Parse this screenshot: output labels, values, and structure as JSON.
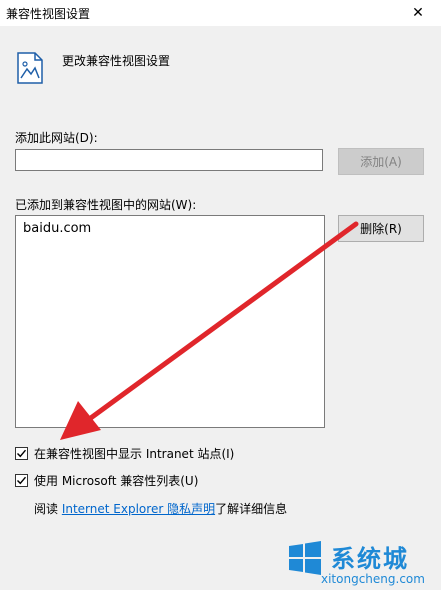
{
  "window": {
    "title": "兼容性视图设置",
    "close_symbol": "✕"
  },
  "header": {
    "text": "更改兼容性视图设置",
    "icon": "document-image-icon"
  },
  "add_site": {
    "label": "添加此网站(D):",
    "input_value": "",
    "input_placeholder": "",
    "button_label": "添加(A)"
  },
  "site_list": {
    "label": "已添加到兼容性视图中的网站(W):",
    "items": [
      "baidu.com"
    ],
    "remove_label": "删除(R)"
  },
  "options": {
    "intranet_label": "在兼容性视图中显示 Intranet 站点(I)",
    "intranet_checked": true,
    "ms_list_label": "使用 Microsoft 兼容性列表(U)",
    "ms_list_checked": true
  },
  "privacy": {
    "prefix": "阅读 ",
    "link_text": "Internet Explorer 隐私声明",
    "suffix": "了解详细信息"
  },
  "watermark": {
    "title": "系统城",
    "url": "xitongcheng.com"
  },
  "colors": {
    "accent_link": "#0066cc",
    "arrow": "#e0262b",
    "watermark": "#1f89d6"
  }
}
